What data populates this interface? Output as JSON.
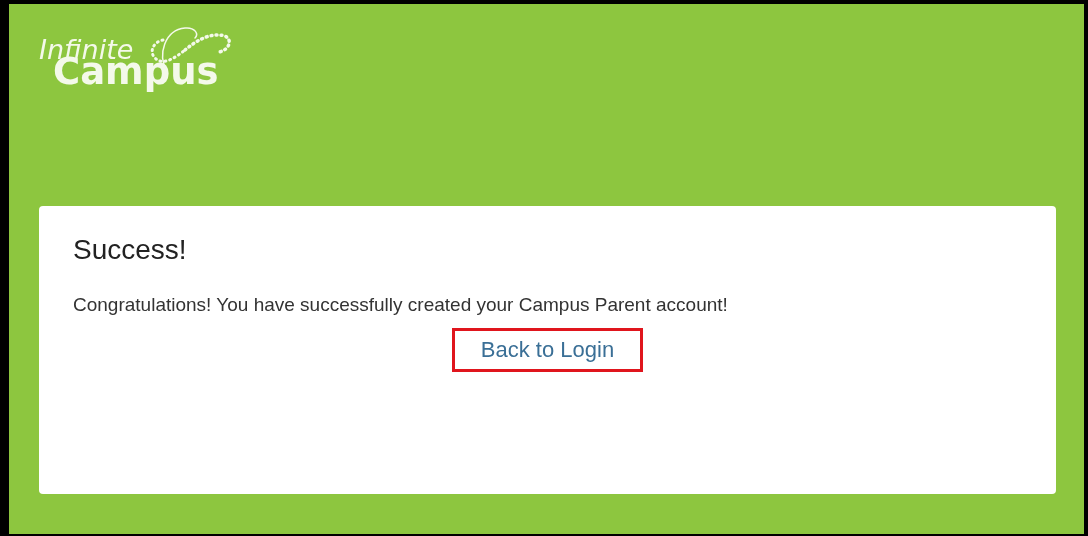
{
  "logo": {
    "line_1": "Infinite",
    "line_2": "Campus"
  },
  "card": {
    "title": "Success!",
    "message": "Congratulations! You have successfully created your Campus Parent account!",
    "link": {
      "label": "Back to Login",
      "highlighted": true
    }
  }
}
